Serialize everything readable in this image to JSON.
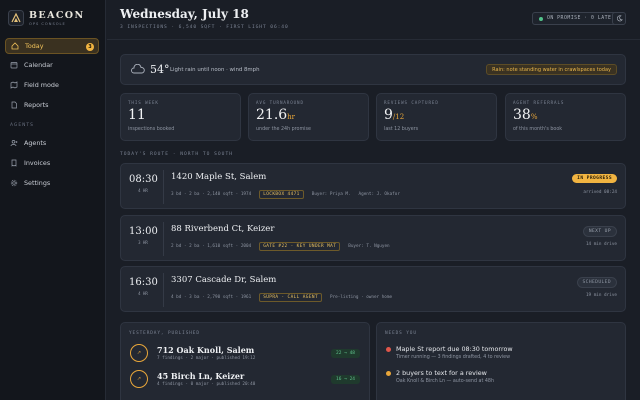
{
  "brand": {
    "name": "BEACON",
    "subtitle": "OPS CONSOLE"
  },
  "sidebar": {
    "nav": [
      {
        "label": "Today",
        "icon": "home-icon",
        "active": true,
        "count": "3"
      },
      {
        "label": "Calendar",
        "icon": "calendar-icon"
      },
      {
        "label": "Field mode",
        "icon": "map-icon"
      },
      {
        "label": "Reports",
        "icon": "file-icon"
      }
    ],
    "section": "AGENTS",
    "nav2": [
      {
        "label": "Agents",
        "icon": "user-add-icon"
      },
      {
        "label": "Invoices",
        "icon": "receipt-icon"
      },
      {
        "label": "Settings",
        "icon": "gear-icon"
      }
    ]
  },
  "header": {
    "date": "Wednesday, July 18",
    "subline": "3 INSPECTIONS · 6,540 SQFT · FIRST LIGHT 06:40",
    "status": "ON PROMISE · 0 LATE"
  },
  "weather": {
    "temp": "54°",
    "desc": "Light rain until noon · wind 8mph",
    "alert": "Rain: note standing water in crawlspaces today"
  },
  "stats": [
    {
      "label": "THIS WEEK",
      "value": "11",
      "unit": "",
      "note": "inspections booked"
    },
    {
      "label": "AVG TURNAROUND",
      "value": "21.6",
      "unit": "hr",
      "note": "under the 24h promise"
    },
    {
      "label": "REVIEWS CAPTURED",
      "value": "9",
      "unit": "/12",
      "note": "last 12 buyers"
    },
    {
      "label": "AGENT REFERRALS",
      "value": "38",
      "unit": "%",
      "note": "of this month's book"
    }
  ],
  "route_label": "TODAY'S ROUTE · NORTH TO SOUTH",
  "route": [
    {
      "time": "08:30",
      "sub": "4 HR",
      "address": "1420 Maple St, Salem",
      "specs": "3 bd · 2 ba · 2,140 sqft · 1974",
      "tag": "LOCKBOX 4471",
      "buyer": "Buyer: Priya M.",
      "agent": "Agent: J. Okafor",
      "status": "IN PROGRESS",
      "eta": "arrived 08:24"
    },
    {
      "time": "13:00",
      "sub": "3 HR",
      "address": "88 Riverbend Ct, Keizer",
      "specs": "2 bd · 2 ba · 1,610 sqft · 2004",
      "tag": "GATE #22 · KEY UNDER MAT",
      "buyer": "Buyer: T. Nguyen",
      "agent": "",
      "status": "NEXT UP",
      "eta": "14 min drive"
    },
    {
      "time": "16:30",
      "sub": "4 HR",
      "address": "3307 Cascade Dr, Salem",
      "specs": "4 bd · 3 ba · 2,790 sqft · 1961",
      "tag": "SUPRA · CALL AGENT",
      "buyer": "Pre-listing · owner home",
      "agent": "",
      "status": "SCHEDULED",
      "eta": "19 min drive"
    }
  ],
  "published": {
    "label": "YESTERDAY, PUBLISHED",
    "items": [
      {
        "address": "712 Oak Knoll, Salem",
        "sub": "7 findings · 2 major · published 19:12",
        "action": "22 → 48",
        "ring": "↗"
      },
      {
        "address": "45 Birch Ln, Keizer",
        "sub": "4 findings · 0 major · published 20:40",
        "action": "16 → 24",
        "ring": "↗"
      }
    ]
  },
  "needs": {
    "label": "NEEDS YOU",
    "items": [
      {
        "title": "Maple St report due 08:30 tomorrow",
        "sub": "Timer running — 3 findings drafted, 4 to review",
        "color": "#e0564a"
      },
      {
        "title": "2 buyers to text for a review",
        "sub": "Oak Knoll & Birch Ln — auto-send at 48h",
        "color": "#e8a63a"
      }
    ]
  },
  "colors": {
    "accent": "#f1b441",
    "bg": "#1a1e26",
    "panel": "#232832",
    "ok": "#52c28a"
  }
}
